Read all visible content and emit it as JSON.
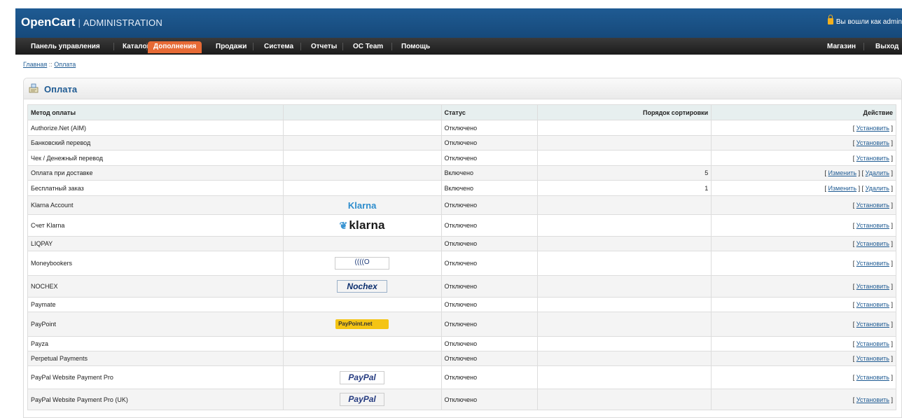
{
  "header": {
    "brand": "OpenCart",
    "separator": "|",
    "subtitle": "ADMINISTRATION",
    "login_text": "Вы вошли как admin"
  },
  "menu": {
    "left": [
      "Панель управления",
      "Каталог",
      "Дополнения",
      "Продажи",
      "Система",
      "Отчеты",
      "OC Team",
      "Помощь"
    ],
    "active": "Дополнения",
    "right": [
      "Магазин",
      "Выход"
    ]
  },
  "breadcrumb": {
    "home": "Главная",
    "separator": " :: ",
    "current": "Оплата"
  },
  "page": {
    "title": "Оплата"
  },
  "table": {
    "headers": [
      "Метод оплаты",
      "",
      "Статус",
      "Порядок сортировки",
      "Действие"
    ],
    "rows": [
      {
        "name": "Authorize.Net (AIM)",
        "logo": "",
        "status": "Отключено",
        "sort": "",
        "actions": [
          "Установить"
        ]
      },
      {
        "name": "Банковский перевод",
        "logo": "",
        "status": "Отключено",
        "sort": "",
        "actions": [
          "Установить"
        ]
      },
      {
        "name": "Чек / Денежный перевод",
        "logo": "",
        "status": "Отключено",
        "sort": "",
        "actions": [
          "Установить"
        ]
      },
      {
        "name": "Оплата при доставке",
        "logo": "",
        "status": "Включено",
        "sort": "5",
        "actions": [
          "Изменить",
          "Удалить"
        ]
      },
      {
        "name": "Бесплатный заказ",
        "logo": "",
        "status": "Включено",
        "sort": "1",
        "actions": [
          "Изменить",
          "Удалить"
        ]
      },
      {
        "name": "Klarna Account",
        "logo": "Klarna",
        "status": "Отключено",
        "sort": "",
        "actions": [
          "Установить"
        ]
      },
      {
        "name": "Счет Klarna",
        "logo": "klarna",
        "status": "Отключено",
        "sort": "",
        "actions": [
          "Установить"
        ]
      },
      {
        "name": "LIQPAY",
        "logo": "",
        "status": "Отключено",
        "sort": "",
        "actions": [
          "Установить"
        ]
      },
      {
        "name": "Moneybookers",
        "logo": "((((O",
        "status": "Отключено",
        "sort": "",
        "actions": [
          "Установить"
        ]
      },
      {
        "name": "NOCHEX",
        "logo": "Nochex",
        "status": "Отключено",
        "sort": "",
        "actions": [
          "Установить"
        ]
      },
      {
        "name": "Paymate",
        "logo": "",
        "status": "Отключено",
        "sort": "",
        "actions": [
          "Установить"
        ]
      },
      {
        "name": "PayPoint",
        "logo": "PayPoint.net",
        "status": "Отключено",
        "sort": "",
        "actions": [
          "Установить"
        ]
      },
      {
        "name": "Payza",
        "logo": "",
        "status": "Отключено",
        "sort": "",
        "actions": [
          "Установить"
        ]
      },
      {
        "name": "Perpetual Payments",
        "logo": "",
        "status": "Отключено",
        "sort": "",
        "actions": [
          "Установить"
        ]
      },
      {
        "name": "PayPal Website Payment Pro",
        "logo": "PayPal",
        "status": "Отключено",
        "sort": "",
        "actions": [
          "Установить"
        ]
      },
      {
        "name": "PayPal Website Payment Pro (UK)",
        "logo": "PayPal",
        "status": "Отключено",
        "sort": "",
        "actions": [
          "Установить"
        ]
      }
    ]
  },
  "colors": {
    "header_blue": "#1f5b93",
    "menu_dark": "#2a2a2a",
    "menu_active": "#e76a35",
    "link": "#1f5b93"
  }
}
